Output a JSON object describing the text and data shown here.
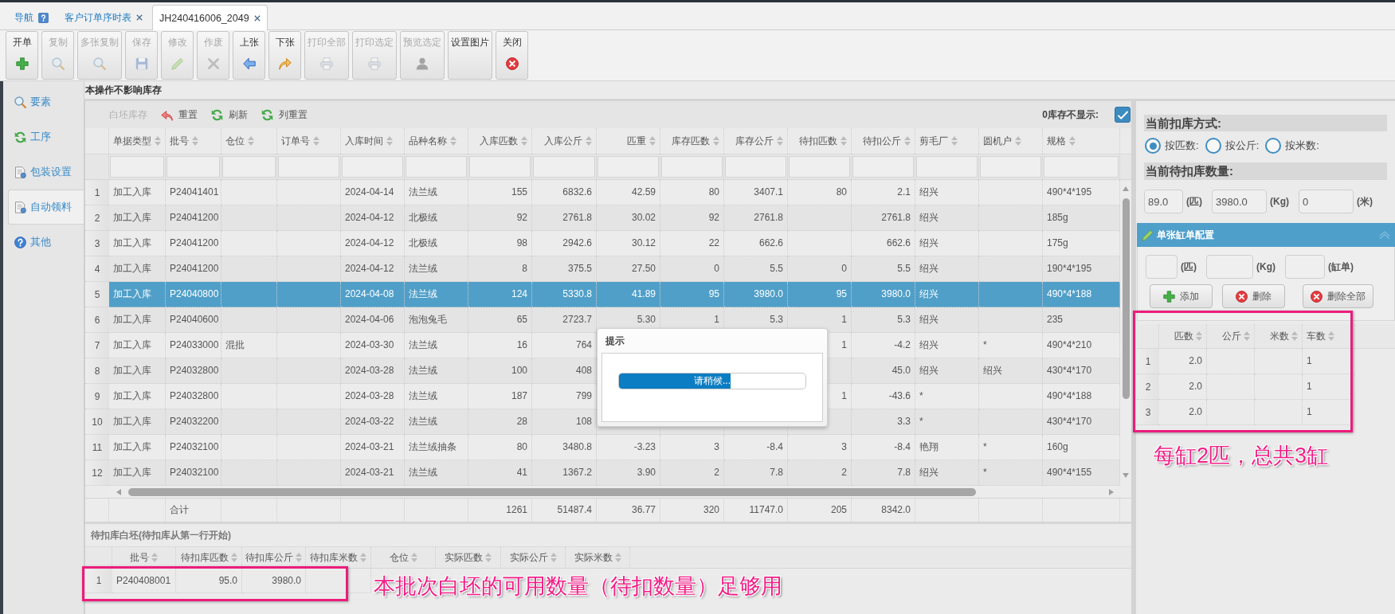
{
  "tabs": [
    {
      "label": "导航",
      "kind": "nav",
      "selected": false
    },
    {
      "label": "客户订单序时表",
      "kind": "page",
      "selected": false
    },
    {
      "label": "JH240416006_2049",
      "kind": "page",
      "selected": true
    }
  ],
  "toolbar": [
    {
      "label": "开单",
      "kind": "new",
      "disabled": false
    },
    {
      "label": "复制",
      "kind": "copy",
      "disabled": true
    },
    {
      "label": "多张复制",
      "kind": "multi_copy",
      "disabled": true
    },
    {
      "label": "保存",
      "kind": "save",
      "disabled": true
    },
    {
      "label": "修改",
      "kind": "edit",
      "disabled": true
    },
    {
      "label": "作废",
      "kind": "void",
      "disabled": true
    },
    {
      "label": "上张",
      "kind": "previous",
      "disabled": false
    },
    {
      "label": "下张",
      "kind": "next",
      "disabled": false
    },
    {
      "label": "打印全部",
      "kind": "print_all",
      "disabled": true
    },
    {
      "label": "打印选定",
      "kind": "print_selected",
      "disabled": true
    },
    {
      "label": "预览选定",
      "kind": "preview",
      "disabled": true
    },
    {
      "label": "设置图片",
      "kind": "image_settings",
      "disabled": false
    },
    {
      "label": "关闭",
      "kind": "close",
      "disabled": false
    }
  ],
  "sidebar": {
    "items": [
      {
        "label": "要素",
        "kind": "elements",
        "selected": false
      },
      {
        "label": "工序",
        "kind": "process",
        "selected": false
      },
      {
        "label": "包装设置",
        "kind": "packaging",
        "selected": false
      },
      {
        "label": "自动领料",
        "kind": "auto_pick",
        "selected": true
      },
      {
        "label": "其他",
        "kind": "other",
        "selected": false
      }
    ]
  },
  "notice": "本操作不影响库存",
  "grid": {
    "toolbar": [
      {
        "label": "白坯库存",
        "kind": "stock",
        "disabled": true
      },
      {
        "label": "重置",
        "kind": "reset",
        "disabled": false
      },
      {
        "label": "刷新",
        "kind": "refresh",
        "disabled": false
      },
      {
        "label": "列重置",
        "kind": "column_reset",
        "disabled": false
      }
    ],
    "zero_stock_hidden": {
      "label": "0库存不显示:",
      "checked": true
    },
    "columns": [
      "单据类型",
      "批号",
      "仓位",
      "订单号",
      "入库时间",
      "品种名称",
      "入库匹数",
      "入库公斤",
      "匹重",
      "库存匹数",
      "库存公斤",
      "待扣匹数",
      "待扣公斤",
      "剪毛厂",
      "圆机户",
      "规格"
    ],
    "rows": [
      {
        "number": "1",
        "selected": false,
        "cells": [
          "加工入库",
          "P24041401",
          null,
          null,
          "2024-04-14",
          "法兰绒",
          "155",
          "6832.6",
          "42.59",
          "80",
          "3407.1",
          "80",
          "2.1",
          "绍兴",
          null,
          "490*4*195"
        ]
      },
      {
        "number": "2",
        "selected": false,
        "cells": [
          "加工入库",
          "P24041200",
          null,
          null,
          "2024-04-12",
          "北极绒",
          "92",
          "2761.8",
          "30.02",
          "92",
          "2761.8",
          null,
          "2761.8",
          "绍兴",
          null,
          "185g"
        ]
      },
      {
        "number": "3",
        "selected": false,
        "cells": [
          "加工入库",
          "P24041200",
          null,
          null,
          "2024-04-12",
          "北极绒",
          "98",
          "2942.6",
          "30.12",
          "22",
          "662.6",
          null,
          "662.6",
          "绍兴",
          null,
          "175g"
        ]
      },
      {
        "number": "4",
        "selected": false,
        "cells": [
          "加工入库",
          "P24041200",
          null,
          null,
          "2024-04-12",
          "法兰绒",
          "8",
          "375.5",
          "27.50",
          "0",
          "5.5",
          "0",
          "5.5",
          "绍兴",
          null,
          "190*4*195"
        ]
      },
      {
        "number": "5",
        "selected": true,
        "cells": [
          "加工入库",
          "P24040800",
          null,
          null,
          "2024-04-08",
          "法兰绒",
          "124",
          "5330.8",
          "41.89",
          "95",
          "3980.0",
          "95",
          "3980.0",
          "绍兴",
          null,
          "490*4*188"
        ]
      },
      {
        "number": "6",
        "selected": false,
        "cells": [
          "加工入库",
          "P24040600",
          null,
          null,
          "2024-04-06",
          "泡泡兔毛",
          "65",
          "2723.7",
          "5.30",
          "1",
          "5.3",
          "1",
          "5.3",
          "绍兴",
          null,
          "235"
        ]
      },
      {
        "number": "7",
        "selected": false,
        "cells": [
          "加工入库",
          "P24033000",
          "混批",
          null,
          "2024-03-30",
          "法兰绒",
          "16",
          "764",
          null,
          null,
          null,
          "1",
          "-4.2",
          "绍兴",
          "*",
          "490*4*210"
        ]
      },
      {
        "number": "8",
        "selected": false,
        "cells": [
          "加工入库",
          "P24032800",
          null,
          null,
          "2024-03-28",
          "法兰绒",
          "100",
          "408",
          null,
          null,
          null,
          null,
          "45.0",
          "绍兴",
          "绍兴",
          "430*4*170"
        ]
      },
      {
        "number": "9",
        "selected": false,
        "cells": [
          "加工入库",
          "P24032800",
          null,
          null,
          "2024-03-28",
          "法兰绒",
          "187",
          "799",
          null,
          null,
          null,
          "1",
          "-43.6",
          "*",
          null,
          "490*4*188"
        ]
      },
      {
        "number": "10",
        "selected": false,
        "cells": [
          "加工入库",
          "P24032200",
          null,
          null,
          "2024-03-22",
          "法兰绒",
          "28",
          "108",
          null,
          null,
          null,
          null,
          "3.3",
          "*",
          null,
          "430*4*170"
        ]
      },
      {
        "number": "11",
        "selected": false,
        "cells": [
          "加工入库",
          "P24032100",
          null,
          null,
          "2024-03-21",
          "法兰绒抽条",
          "80",
          "3480.8",
          "-3.23",
          "3",
          "-8.4",
          "3",
          "-8.4",
          "艳翔",
          "*",
          "160g"
        ]
      },
      {
        "number": "12",
        "selected": false,
        "cells": [
          "加工入库",
          "P24032100",
          null,
          null,
          "2024-03-21",
          "法兰绒",
          "41",
          "1367.2",
          "3.90",
          "2",
          "7.8",
          "2",
          "7.8",
          "绍兴",
          "*",
          "490*4*155"
        ]
      }
    ],
    "totals": {
      "label": "合计",
      "values": [
        "1261",
        "51487.4",
        "36.77",
        "320",
        "11747.0",
        "205",
        "8342.0"
      ]
    }
  },
  "dialog": {
    "title": "提示",
    "progress": {
      "level": 0.6,
      "text": "请稍候..."
    }
  },
  "pending_grid": {
    "title": "待扣库白坯(待扣库从第一行开始)",
    "columns": [
      "批号",
      "待扣库匹数",
      "待扣库公斤",
      "待扣库米数",
      "仓位",
      "实际匹数",
      "实际公斤",
      "实际米数"
    ],
    "rows": [
      {
        "number": "1",
        "cells": [
          "P240408001",
          "95.0",
          "3980.0"
        ]
      }
    ]
  },
  "deduction": {
    "mode_title": "当前扣库方式:",
    "modes": [
      {
        "label": "按匹数:",
        "selected": true
      },
      {
        "label": "按公斤:",
        "selected": false
      },
      {
        "label": "按米数:",
        "selected": false
      }
    ],
    "quantity_title": "当前待扣库数量:",
    "quantities": [
      {
        "value": "89.0",
        "unit": "(匹)"
      },
      {
        "value": "3980.0",
        "unit": "(Kg)"
      },
      {
        "value": "0",
        "unit": "(米)"
      }
    ]
  },
  "cylinder_config": {
    "title": "单张缸单配置",
    "fields": [
      {
        "unit": "(匹)"
      },
      {
        "unit": "(Kg)"
      },
      {
        "unit": "(缸单)"
      }
    ],
    "buttons": [
      {
        "label": "添加",
        "kind": "add"
      },
      {
        "label": "删除",
        "kind": "delete"
      },
      {
        "label": "删除全部",
        "kind": "delete_all"
      }
    ]
  },
  "cylinder_grid": {
    "columns": [
      "匹数",
      "公斤",
      "米数",
      "车数"
    ],
    "rows": [
      {
        "number": "1",
        "cells": [
          "2.0",
          null,
          null,
          "1"
        ]
      },
      {
        "number": "2",
        "cells": [
          "2.0",
          null,
          null,
          "1"
        ]
      },
      {
        "number": "3",
        "cells": [
          "2.0",
          null,
          null,
          "1"
        ]
      }
    ]
  },
  "annotations": [
    {
      "text": "每缸2匹，总共3缸"
    },
    {
      "text": "本批次白坯的可用数量（待扣数量）足够用"
    }
  ]
}
